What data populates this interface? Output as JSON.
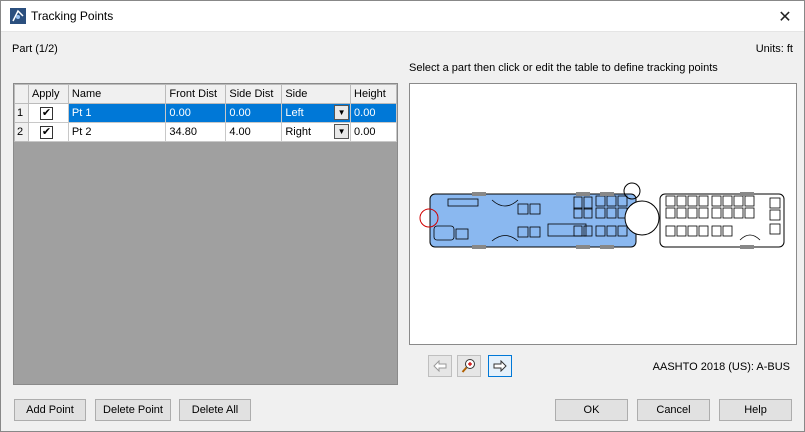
{
  "window": {
    "title": "Tracking Points",
    "close_glyph": "✕"
  },
  "part_label": "Part (1/2)",
  "units_label": "Units: ft",
  "instruction": "Select a part then click or edit the table to define tracking points",
  "table": {
    "headers": [
      "",
      "Apply",
      "Name",
      "Front Dist",
      "Side Dist",
      "Side",
      "Height"
    ],
    "rows": [
      {
        "num": "1",
        "apply": "✔",
        "name": "Pt 1",
        "front": "0.00",
        "side_dist": "0.00",
        "side": "Left",
        "height": "0.00"
      },
      {
        "num": "2",
        "apply": "✔",
        "name": "Pt 2",
        "front": "34.80",
        "side_dist": "4.00",
        "side": "Right",
        "height": "0.00"
      }
    ]
  },
  "vehicle_label": "AASHTO 2018 (US): A-BUS",
  "buttons": {
    "add_point": "Add Point",
    "delete_point": "Delete Point",
    "delete_all": "Delete All",
    "ok": "OK",
    "cancel": "Cancel",
    "help": "Help"
  },
  "colors": {
    "selection": "#0078d7",
    "part_fill": "#8ab8f0"
  }
}
